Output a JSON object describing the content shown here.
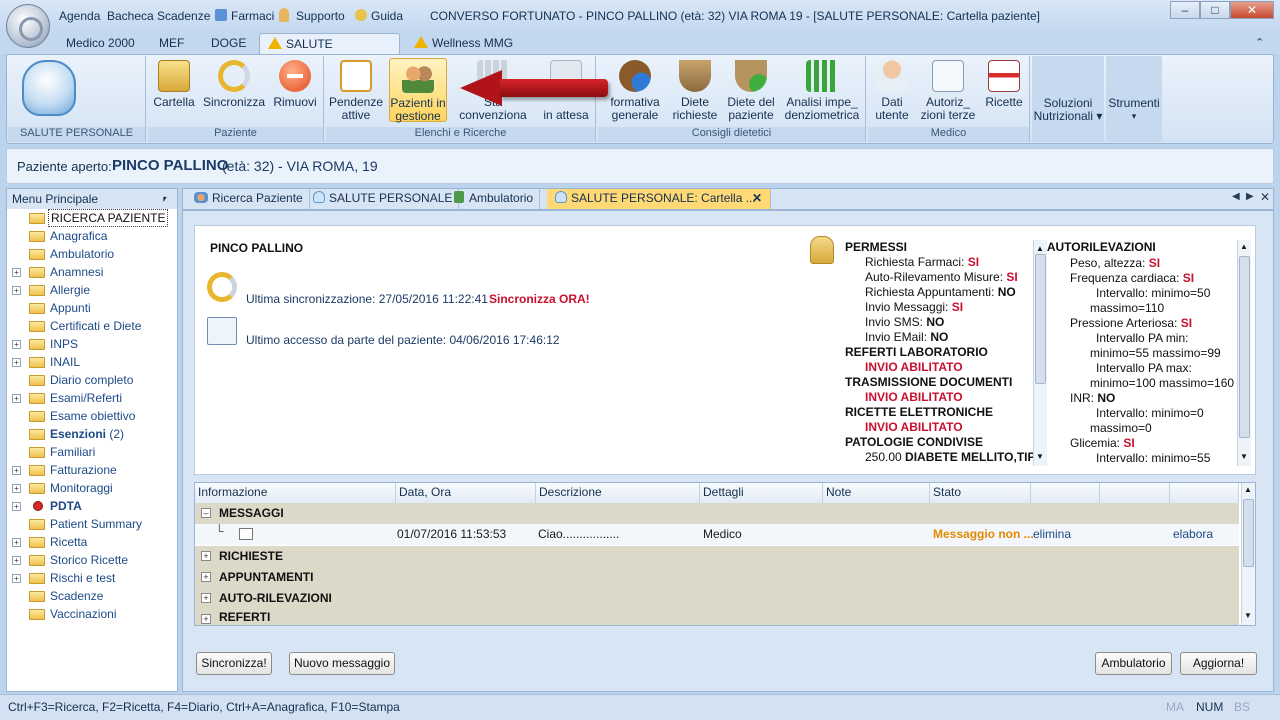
{
  "quick_access": [
    "Agenda",
    "Bacheca",
    "Scadenze",
    "Farmaci",
    "Supporto",
    "Guida"
  ],
  "window_title": "CONVERSO FORTUNATO - PINCO PALLINO (età: 32) VIA ROMA 19 - [SALUTE PERSONALE: Cartella paziente]",
  "ribbon_tabs": [
    "Medico 2000",
    "MEF",
    "DOGE",
    "SALUTE PERSONALE",
    "Wellness MMG"
  ],
  "ribbon": {
    "logo_caption": "SALUTE PERSONALE",
    "paziente_group": "Paziente",
    "elenchi_group": "Elenchi e Ricerche",
    "consigli_group": "Consigli dietetici",
    "medico_group": "Medico",
    "btn_cartella": "Cartella",
    "btn_sincronizza": "Sincronizza",
    "btn_rimuovi": "Rimuovi",
    "btn_pendenze_1": "Pendenze",
    "btn_pendenze_2": "attive",
    "btn_pazienti_1": "Pazienti in",
    "btn_pazienti_2": "gestione",
    "btn_stato_1": "Sta",
    "btn_stato_2": "convenziona",
    "btn_attesa_2": "in attesa",
    "btn_informativa_1": "formativa",
    "btn_informativa_2": "generale",
    "btn_diete_1": "Diete",
    "btn_diete_2": "richieste",
    "btn_dietepaz_1": "Diete del",
    "btn_dietepaz_2": "paziente",
    "btn_analisi_1": "Analisi impe_",
    "btn_analisi_2": "denziometrica",
    "btn_dati_1": "Dati",
    "btn_dati_2": "utente",
    "btn_autor_1": "Autoriz_",
    "btn_autor_2": "zioni terze",
    "btn_ricette": "Ricette",
    "btn_soluzioni_1": "Soluzioni",
    "btn_soluzioni_2": "Nutrizionali",
    "btn_strumenti": "Strumenti"
  },
  "patient_bar": {
    "label": "Paziente aperto:",
    "name": "PINCO PALLINO",
    "details": "(età: 32) - VIA ROMA, 19"
  },
  "menu": {
    "title": "Menu Principale",
    "items": [
      {
        "label": "RICERCA PAZIENTE",
        "expand": ""
      },
      {
        "label": "Anagrafica",
        "expand": ""
      },
      {
        "label": "Ambulatorio",
        "expand": ""
      },
      {
        "label": "Anamnesi",
        "expand": "+"
      },
      {
        "label": "Allergie",
        "expand": "+"
      },
      {
        "label": "Appunti",
        "expand": ""
      },
      {
        "label": "Certificati e Diete",
        "expand": ""
      },
      {
        "label": "INPS",
        "expand": "+"
      },
      {
        "label": "INAIL",
        "expand": "+"
      },
      {
        "label": "Diario completo",
        "expand": ""
      },
      {
        "label": "Esami/Referti",
        "expand": "+"
      },
      {
        "label": "Esame obiettivo",
        "expand": ""
      },
      {
        "label": "Esenzioni",
        "count": "(2)",
        "expand": "",
        "bold": true
      },
      {
        "label": "Familiari",
        "expand": ""
      },
      {
        "label": "Fatturazione",
        "expand": "+"
      },
      {
        "label": "Monitoraggi",
        "expand": "+"
      },
      {
        "label": "PDTA",
        "expand": "+",
        "bold": true,
        "icon": "red-dot"
      },
      {
        "label": "Patient Summary",
        "expand": ""
      },
      {
        "label": "Ricetta",
        "expand": "+"
      },
      {
        "label": "Storico Ricette",
        "expand": "+"
      },
      {
        "label": "Rischi e test",
        "expand": "+"
      },
      {
        "label": "Scadenze",
        "expand": ""
      },
      {
        "label": "Vaccinazioni",
        "expand": ""
      }
    ]
  },
  "content_tabs": [
    "Ricerca Paziente",
    "SALUTE PERSONALE",
    "Ambulatorio",
    "SALUTE PERSONALE: Cartella ..."
  ],
  "panel": {
    "patient_name": "PINCO PALLINO",
    "sync_text": "Ultima sincronizzazione: 27/05/2016 11:22:41",
    "sync_now": "Sincronizza ORA!",
    "last_access": "Ultimo accesso da parte del paziente: 04/06/2016 17:46:12"
  },
  "permessi": {
    "title": "PERMESSI",
    "farmaci_label": "Richiesta Farmaci:",
    "farmaci_val": "SI",
    "autoril_label": "Auto-Rilevamento Misure:",
    "autoril_val": "SI",
    "appunt_label": "Richiesta Appuntamenti:",
    "appunt_val": "NO",
    "msg_label": "Invio Messaggi:",
    "msg_val": "SI",
    "sms_label": "Invio SMS:",
    "sms_val": "NO",
    "email_label": "Invio EMail:",
    "email_val": "NO",
    "ref_title": "REFERTI LABORATORIO",
    "ref_val": "INVIO ABILITATO",
    "doc_title": "TRASMISSIONE DOCUMENTI",
    "doc_val": "INVIO ABILITATO",
    "ric_title": "RICETTE ELETTRONICHE",
    "ric_val": "INVIO ABILITATO",
    "pat_title": "PATOLOGIE CONDIVISE",
    "pat_code": "250.00",
    "pat_name": "DIABETE MELLITO,TIPO"
  },
  "autoril": {
    "title": "AUTORILEVAZIONI",
    "peso_label": "Peso, altezza:",
    "peso_val": "SI",
    "freq_label": "Frequenza cardiaca:",
    "freq_val": "SI",
    "freq_int_1": "Intervallo: minimo=50",
    "freq_int_2": "massimo=110",
    "press_label": "Pressione Arteriosa:",
    "press_val": "SI",
    "pa_min_1": "Intervallo PA min:",
    "pa_min_2": "minimo=55 massimo=99",
    "pa_max_1": "Intervallo PA max:",
    "pa_max_2": "minimo=100 massimo=160",
    "inr_label": "INR:",
    "inr_val": "NO",
    "inr_int_1": "Intervallo: minimo=0",
    "inr_int_2": "massimo=0",
    "gli_label": "Glicemia:",
    "gli_val": "SI",
    "gli_int": "Intervallo: minimo=55"
  },
  "grid": {
    "columns": [
      "Informazione",
      "Data, Ora",
      "Descrizione",
      "Dettagli",
      "Note",
      "Stato"
    ],
    "groups": [
      "MESSAGGI",
      "RICHIESTE",
      "APPUNTAMENTI",
      "AUTO-RILEVAZIONI",
      "REFERTI"
    ],
    "message_row": {
      "date": "01/07/2016 11:53:53",
      "descr": "Ciao.................",
      "details": "Medico",
      "state": "Messaggio non ...",
      "elimina": "elimina",
      "elabora": "elabora"
    }
  },
  "buttons": {
    "sincronizza": "Sincronizza!",
    "nuovo_messaggio": "Nuovo messaggio",
    "ambulatorio": "Ambulatorio",
    "aggiorna": "Aggiorna!"
  },
  "status": {
    "shortcuts": "Ctrl+F3=Ricerca, F2=Ricetta, F4=Diario, Ctrl+A=Anagrafica, F10=Stampa",
    "ma": "MA",
    "num": "NUM",
    "bs": "BS"
  },
  "colors": {
    "red": "#c8102e",
    "orange": "#e08a00",
    "link": "#1d4a87",
    "highlight": "#ffd976"
  }
}
